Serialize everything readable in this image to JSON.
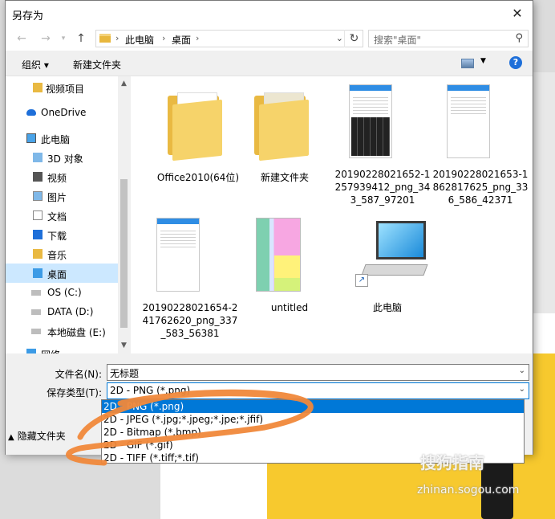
{
  "title": "另存为",
  "address": {
    "crumbs": [
      "此电脑",
      "桌面"
    ]
  },
  "search": {
    "placeholder": "搜索\"桌面\""
  },
  "toolbar": {
    "organize": "组织 ▾",
    "new_folder": "新建文件夹"
  },
  "sidebar": {
    "items": [
      {
        "label": "视频项目",
        "icon": "folder-icon"
      },
      {
        "label": "OneDrive",
        "icon": "cloud-icon"
      },
      {
        "label": "此电脑",
        "icon": "computer-icon"
      },
      {
        "label": "3D 对象",
        "icon": "cube-icon"
      },
      {
        "label": "视频",
        "icon": "video-icon"
      },
      {
        "label": "图片",
        "icon": "picture-icon"
      },
      {
        "label": "文档",
        "icon": "document-icon"
      },
      {
        "label": "下载",
        "icon": "download-icon"
      },
      {
        "label": "音乐",
        "icon": "music-icon"
      },
      {
        "label": "桌面",
        "icon": "desktop-icon",
        "selected": true
      },
      {
        "label": "OS (C:)",
        "icon": "drive-icon"
      },
      {
        "label": "DATA (D:)",
        "icon": "drive-icon"
      },
      {
        "label": "本地磁盘 (E:)",
        "icon": "drive-icon"
      },
      {
        "label": "网络",
        "icon": "network-icon"
      }
    ]
  },
  "files": [
    {
      "name": "Office2010(64位)",
      "kind": "folder"
    },
    {
      "name": "新建文件夹",
      "kind": "folder"
    },
    {
      "name": "20190228021652-1257939412_png_343_587_97201",
      "kind": "image"
    },
    {
      "name": "20190228021653-1862817625_png_336_586_42371",
      "kind": "image"
    },
    {
      "name": "20190228021654-241762620_png_337_583_56381",
      "kind": "image"
    },
    {
      "name": "untitled",
      "kind": "image"
    },
    {
      "name": "此电脑",
      "kind": "shortcut"
    }
  ],
  "form": {
    "filename_label": "文件名(N):",
    "filename_value": "无标题",
    "filetype_label": "保存类型(T):",
    "filetype_value": "2D - PNG (*.png)"
  },
  "filetype_options": [
    "2D - PNG (*.png)",
    "2D - JPEG (*.jpg;*.jpeg;*.jpe;*.jfif)",
    "2D - Bitmap (*.bmp)",
    "2D - GIF (*.gif)",
    "2D - TIFF (*.tiff;*.tif)"
  ],
  "hide_folders": "隐藏文件夹",
  "watermark": {
    "brand": "搜狗指南",
    "url": "zhinan.sogou.com"
  },
  "colors": {
    "accent": "#0078d7",
    "annotation": "#f0883a"
  }
}
